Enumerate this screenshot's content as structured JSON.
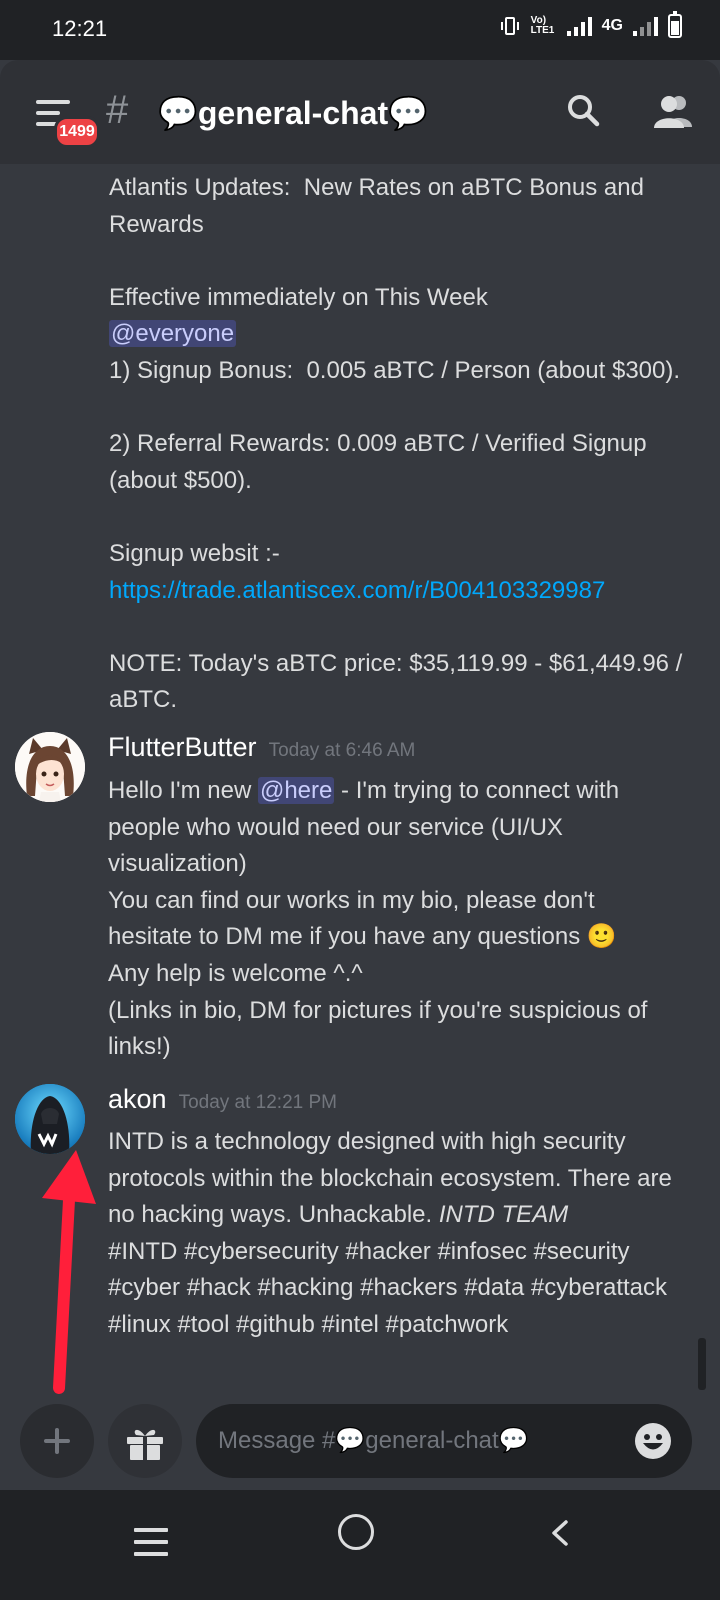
{
  "status_bar": {
    "time": "12:21",
    "volte": "Vo) LTE1",
    "network": "4G"
  },
  "header": {
    "unread_badge": "1499",
    "channel_name": "💬general-chat💬",
    "hash_glyph": "#"
  },
  "messages": {
    "announcement": {
      "lines": [
        "Atlantis Updates:  New Rates on aBTC Bonus and",
        "Rewards",
        "",
        "Effective immediately on This Week",
        "",
        "1) Signup Bonus:  0.005 aBTC / Person (about $300).",
        "",
        "2) Referral Rewards: 0.009 aBTC / Verified Signup",
        "(about $500).",
        "",
        "Signup websit :-",
        "",
        "",
        "NOTE: Today's aBTC price: $35,119.99 - $61,449.96 /",
        "aBTC."
      ],
      "mention": "@everyone",
      "link": "https://trade.atlantiscex.com/r/B004103329987"
    },
    "flutterbutter": {
      "username": "FlutterButter",
      "timestamp": "Today at 6:46 AM",
      "line1_before": "Hello I'm new ",
      "mention": "@here",
      "line1_after": " - I'm trying to connect with",
      "line2": "people who would need our service (UI/UX",
      "line3": "visualization)",
      "line4": "You can find our works in my bio, please don't",
      "line5": "hesitate to DM me if you have any questions ",
      "emoji": "🙂",
      "line6": "Any help is welcome ^.^",
      "line7": "(Links in bio, DM for pictures if you're suspicious of",
      "line8": "links!)"
    },
    "akon": {
      "username": "akon",
      "timestamp": "Today at 12:21 PM",
      "line1": "INTD is a technology designed with high security",
      "line2": "protocols within the blockchain ecosystem. There are",
      "line3_before": "no hacking ways. Unhackable. ",
      "line3_italic": "INTD TEAM",
      "line4": "#INTD #cybersecurity #hacker #infosec #security",
      "line5": "#cyber #hack #hacking #hackers #data #cyberattack",
      "line6": "#linux #tool #github #intel #patchwork"
    }
  },
  "composer": {
    "placeholder": "Message #💬general-chat💬"
  },
  "colors": {
    "background": "#36393f",
    "header": "#2f3136",
    "mention_bg": "#414675",
    "link": "#00a8fc",
    "badge": "#ed4245",
    "annotation_arrow": "#ff1f3a"
  },
  "icons": [
    "hamburger-menu-icon",
    "search-icon",
    "members-icon",
    "plus-icon",
    "gift-icon",
    "emoji-icon",
    "nav-recents-icon",
    "nav-home-icon",
    "nav-back-icon"
  ]
}
